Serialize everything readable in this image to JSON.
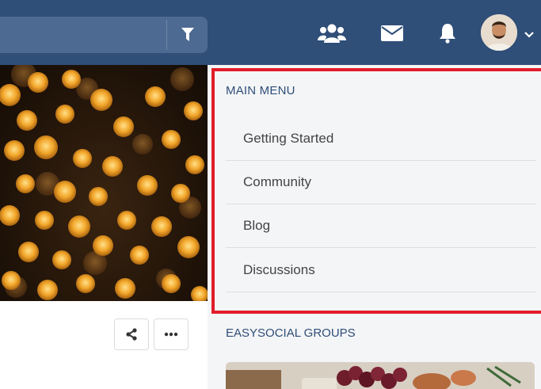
{
  "header": {
    "search": {
      "value": "",
      "placeholder": ""
    },
    "icons": {
      "filter": "filter-icon",
      "friends": "users-icon",
      "messages": "envelope-icon",
      "notifications": "bell-icon",
      "caret": "chevron-down-icon"
    },
    "colors": {
      "bar": "#2f4e78",
      "search": "#4d6a92"
    }
  },
  "post": {
    "actions": [
      {
        "icon": "share-icon"
      },
      {
        "icon": "ellipsis-icon"
      }
    ]
  },
  "main_menu": {
    "heading": "MAIN MENU",
    "items": [
      {
        "label": "Getting Started"
      },
      {
        "label": "Community"
      },
      {
        "label": "Blog"
      },
      {
        "label": "Discussions"
      }
    ],
    "highlight_color": "#e11d2a"
  },
  "groups": {
    "heading": "EASYSOCIAL GROUPS"
  }
}
